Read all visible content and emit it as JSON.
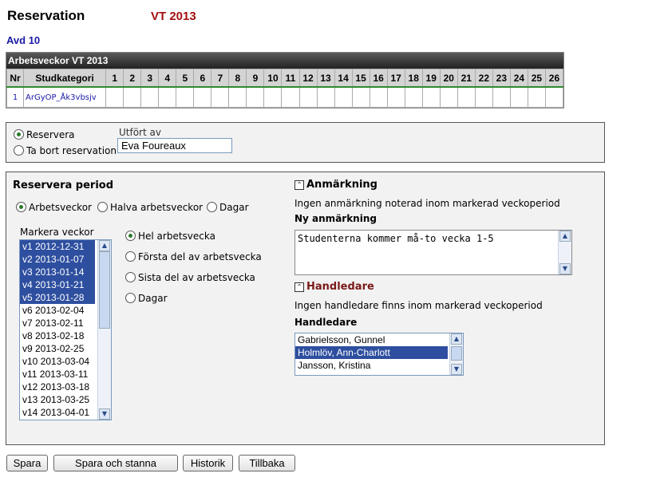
{
  "header": {
    "title": "Reservation",
    "term": "VT 2013",
    "department": "Avd 10"
  },
  "grid": {
    "caption": "Arbetsveckor VT 2013",
    "col_nr": "Nr",
    "col_category": "Studkategori",
    "weeks": [
      "1",
      "2",
      "3",
      "4",
      "5",
      "6",
      "7",
      "8",
      "9",
      "10",
      "11",
      "12",
      "13",
      "14",
      "15",
      "16",
      "17",
      "18",
      "19",
      "20",
      "21",
      "22",
      "23",
      "24",
      "25",
      "26"
    ],
    "rows": [
      {
        "nr": "1",
        "category": "ArGyOP_Åk3vbsjv"
      }
    ]
  },
  "reserve_panel": {
    "option_reserve": "Reservera",
    "option_remove": "Ta bort reservation",
    "performed_by_label": "Utfört av",
    "performed_by_value": "Eva Foureaux"
  },
  "period_panel": {
    "title": "Reservera period",
    "mode_options": [
      "Arbetsveckor",
      "Halva arbetsveckor",
      "Dagar"
    ],
    "weeks_label": "Markera veckor",
    "weeks": [
      {
        "label": "v1 2012-12-31",
        "selected": true
      },
      {
        "label": "v2 2013-01-07",
        "selected": true
      },
      {
        "label": "v3 2013-01-14",
        "selected": true
      },
      {
        "label": "v4 2013-01-21",
        "selected": true
      },
      {
        "label": "v5 2013-01-28",
        "selected": true
      },
      {
        "label": "v6 2013-02-04",
        "selected": false
      },
      {
        "label": "v7 2013-02-11",
        "selected": false
      },
      {
        "label": "v8 2013-02-18",
        "selected": false
      },
      {
        "label": "v9 2013-02-25",
        "selected": false
      },
      {
        "label": "v10 2013-03-04",
        "selected": false
      },
      {
        "label": "v11 2013-03-11",
        "selected": false
      },
      {
        "label": "v12 2013-03-18",
        "selected": false
      },
      {
        "label": "v13 2013-03-25",
        "selected": false
      },
      {
        "label": "v14 2013-04-01",
        "selected": false
      }
    ],
    "week_part_options": [
      "Hel arbetsvecka",
      "Första del av arbetsvecka",
      "Sista del av arbetsvecka",
      "Dagar"
    ]
  },
  "remark": {
    "title": "Anmärkning",
    "info": "Ingen anmärkning noterad inom markerad veckoperiod",
    "new_label": "Ny anmärkning",
    "text": "Studenterna kommer må-to vecka 1-5"
  },
  "supervisor": {
    "title": "Handledare",
    "info": "Ingen handledare finns inom markerad veckoperiod",
    "list_label": "Handledare",
    "items": [
      {
        "name": "Gabrielsson, Gunnel",
        "selected": false
      },
      {
        "name": "Holmlöv, Ann-Charlott",
        "selected": true
      },
      {
        "name": "Jansson, Kristina",
        "selected": false
      }
    ]
  },
  "buttons": {
    "save": "Spara",
    "save_stay": "Spara och stanna",
    "history": "Historik",
    "back": "Tillbaka"
  },
  "colors": {
    "term": "#a01010",
    "link": "#1a1aa6",
    "selection": "#2e4f9f",
    "header_bar": "#2a2a2a"
  }
}
